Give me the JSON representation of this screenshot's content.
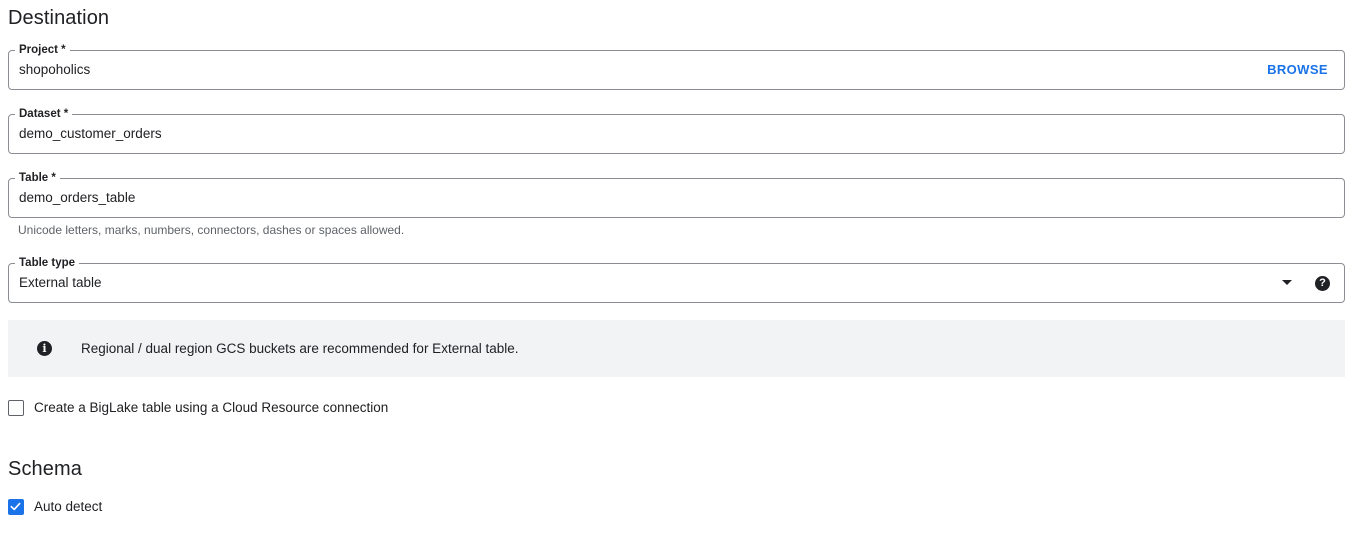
{
  "destination": {
    "title": "Destination",
    "project": {
      "label": "Project *",
      "value": "shopoholics",
      "browse_label": "BROWSE"
    },
    "dataset": {
      "label": "Dataset *",
      "value": "demo_customer_orders"
    },
    "table": {
      "label": "Table *",
      "value": "demo_orders_table",
      "hint": "Unicode letters, marks, numbers, connectors, dashes or spaces allowed."
    },
    "table_type": {
      "label": "Table type",
      "selected": "External table",
      "help_icon": "?"
    },
    "info": {
      "icon": "i",
      "text": "Regional / dual region GCS buckets are recommended for External table."
    },
    "biglake": {
      "label": "Create a BigLake table using a Cloud Resource connection",
      "checked": false
    }
  },
  "schema": {
    "title": "Schema",
    "auto_detect": {
      "label": "Auto detect",
      "checked": true
    }
  },
  "colors": {
    "accent": "#1a73e8",
    "text": "#202124",
    "muted": "#5f6368",
    "banner_bg": "#f1f3f4",
    "border": "#8a8d91"
  }
}
